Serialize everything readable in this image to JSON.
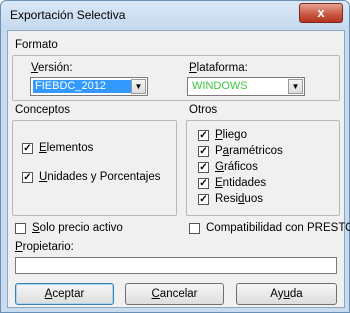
{
  "window": {
    "title": "Exportación Selectiva",
    "close_glyph": "x"
  },
  "formato": {
    "label": "Formato",
    "version": {
      "label_first": "V",
      "label_rest": "ersión:",
      "value": "FIEBDC_2012"
    },
    "plataforma": {
      "label_first": "P",
      "label_rest": "lataforma:",
      "value": "WINDOWS",
      "value_color": "#3cc83c"
    }
  },
  "conceptos": {
    "label": "Conceptos",
    "elementos": {
      "first": "E",
      "rest": "lementos",
      "checked": true
    },
    "unidades": {
      "first": "U",
      "rest": "nidades y Porcentajes",
      "checked": true
    }
  },
  "otros": {
    "label": "Otros",
    "items": [
      {
        "pre": "",
        "u": "P",
        "post": "liego"
      },
      {
        "pre": "P",
        "u": "a",
        "post": "ramétricos"
      },
      {
        "pre": "",
        "u": "G",
        "post": "ráficos"
      },
      {
        "pre": "",
        "u": "E",
        "post": "ntidades"
      },
      {
        "pre": "Resi",
        "u": "d",
        "post": "uos"
      }
    ]
  },
  "solo_precio": {
    "first": "S",
    "rest": "olo precio activo",
    "checked": false
  },
  "compatibilidad": {
    "text": "Compatibilidad con PRESTO",
    "checked": false
  },
  "propietario": {
    "first": "P",
    "rest": "ropietario:",
    "value": ""
  },
  "buttons": {
    "aceptar": {
      "first": "A",
      "rest": "ceptar"
    },
    "cancelar": {
      "first": "C",
      "rest": "ancelar"
    },
    "ayuda": {
      "pre": "Ay",
      "u": "u",
      "post": "da"
    }
  },
  "check_glyph": "✓",
  "dropdown_glyph": "▼"
}
